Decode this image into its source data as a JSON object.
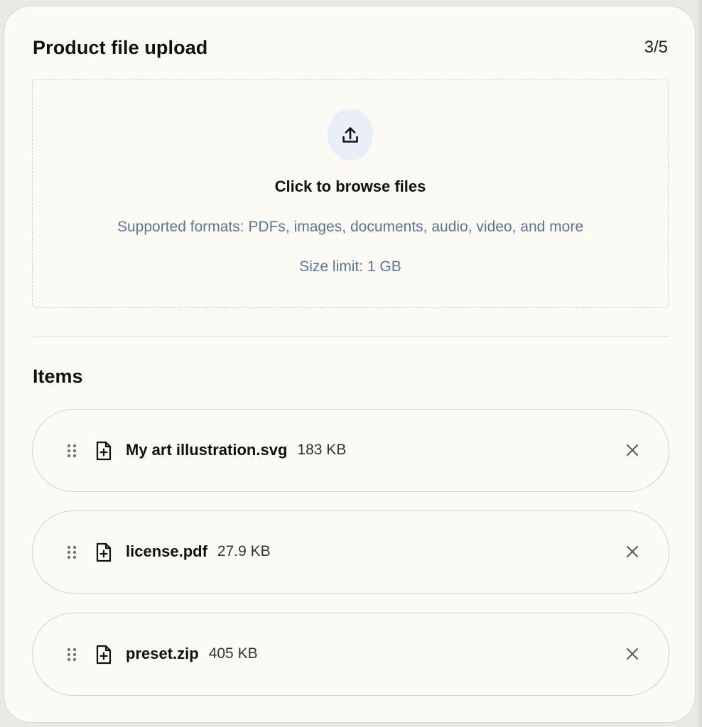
{
  "upload": {
    "title": "Product file upload",
    "step": "3/5",
    "dropzone": {
      "title": "Click to browse files",
      "formats": "Supported formats: PDFs, images, documents, audio, video, and more",
      "size_limit": "Size limit: 1 GB",
      "icon": "upload-icon"
    }
  },
  "items": {
    "heading": "Items",
    "files": [
      {
        "name": "My art illustration.svg",
        "size": "183 KB"
      },
      {
        "name": "license.pdf",
        "size": "27.9 KB"
      },
      {
        "name": "preset.zip",
        "size": "405 KB"
      }
    ]
  },
  "icons": {
    "drag_handle": "drag-handle-icon",
    "file": "file-plus-icon",
    "remove": "close-icon"
  },
  "colors": {
    "card_background": "#fbfaf4",
    "dropzone_border": "#c5cfdb",
    "dropzone_text": "#5f7393",
    "upload_icon_bg": "#eaeef8"
  }
}
